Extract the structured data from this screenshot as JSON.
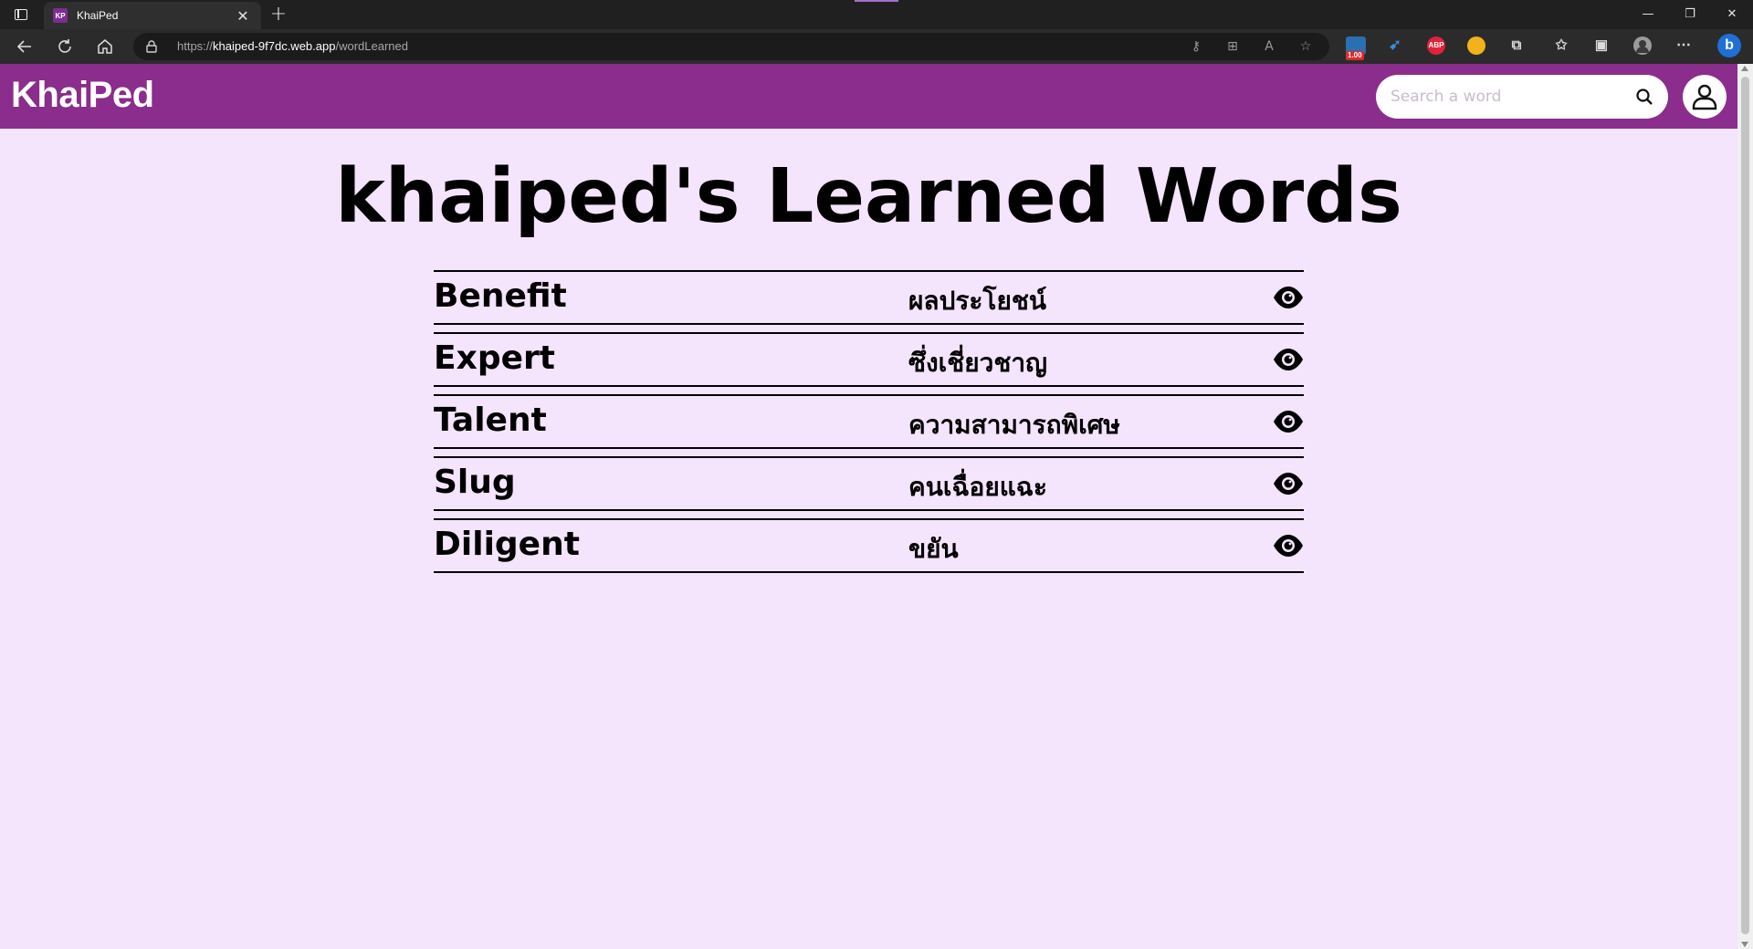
{
  "browser": {
    "tab_title": "KhaiPed",
    "favicon_text": "KP",
    "tab_close": "✕",
    "new_tab": "+",
    "url_prefix": "https://",
    "url_host": "khaiped-9f7dc.web.app",
    "url_path": "/wordLearned",
    "extension_badge": "1.00",
    "abp_label": "ABP",
    "minimize": "—",
    "restore": "❐",
    "close": "✕"
  },
  "header": {
    "logo": "KhaiPed",
    "search_placeholder": "Search a word",
    "brand_color": "#8a2d8c"
  },
  "page": {
    "title": "khaiped's Learned Words",
    "background": "#f4e4fc"
  },
  "words": [
    {
      "english": "Benefit",
      "thai": "ผลประโยชน์"
    },
    {
      "english": "Expert",
      "thai": "ซึ่งเชี่ยวชาญ"
    },
    {
      "english": "Talent",
      "thai": "ความสามารถพิเศษ"
    },
    {
      "english": "Slug",
      "thai": "คนเฉื่อยแฉะ"
    },
    {
      "english": "Diligent",
      "thai": "ขยัน"
    }
  ],
  "icons": {
    "view": "eye-icon",
    "search": "search-icon",
    "account": "user-icon"
  }
}
